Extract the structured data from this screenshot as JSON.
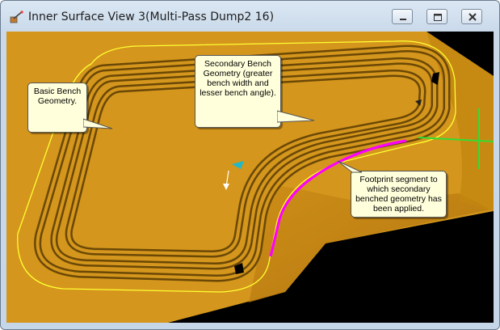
{
  "window": {
    "title": "Inner Surface View 3(Multi-Pass Dump2 16)",
    "controls": [
      "minimize-icon",
      "restore-icon",
      "close-icon"
    ]
  },
  "callouts": {
    "basic": "Basic Bench\nGeometry.",
    "secondary": "Secondary Bench\nGeometry (greater\nbench width and\nlesser bench angle).",
    "footprint": "Footprint segment to\nwhich secondary\nbenched geometry has\nbeen applied."
  },
  "colors": {
    "surface": "#d4961c",
    "outline": "#ffff33",
    "footprint_segment": "#ff00ff",
    "axis_green": "#33dd33",
    "callout_bg": "#ffffdc"
  }
}
